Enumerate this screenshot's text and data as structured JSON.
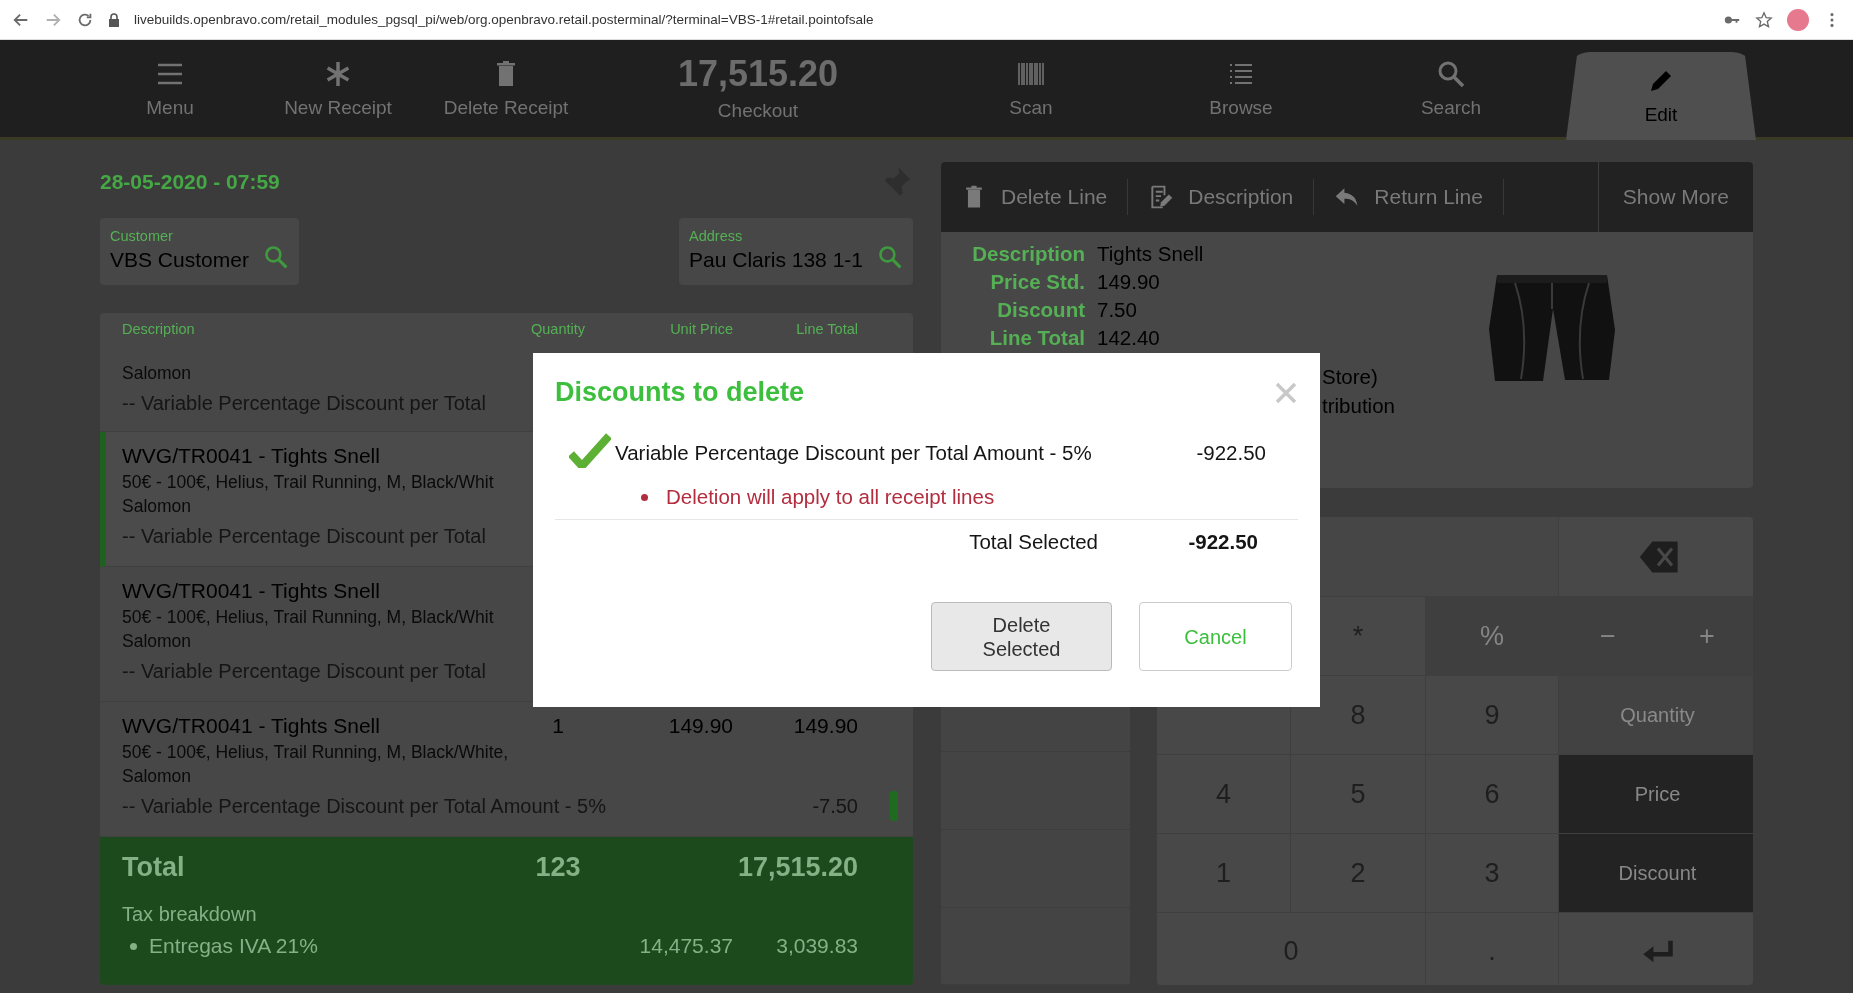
{
  "browser": {
    "url": "livebuilds.openbravo.com/retail_modules_pgsql_pi/web/org.openbravo.retail.posterminal/?terminal=VBS-1#retail.pointofsale"
  },
  "toolbar": [
    {
      "label": "Menu",
      "selected": false
    },
    {
      "label": "New Receipt",
      "selected": false
    },
    {
      "label": "Delete Receipt",
      "selected": false
    },
    {
      "label": "Checkout",
      "amount": "17,515.20",
      "selected": false
    },
    {
      "label": "Scan",
      "selected": false
    },
    {
      "label": "Browse",
      "selected": false
    },
    {
      "label": "Search",
      "selected": false
    },
    {
      "label": "Edit",
      "selected": true
    }
  ],
  "receipt": {
    "date": "28-05-2020 - 07:59",
    "customer": {
      "label": "Customer",
      "value": "VBS Customer"
    },
    "address": {
      "label": "Address",
      "value": "Pau Claris 138 1-1"
    },
    "columns": [
      "Description",
      "Quantity",
      "Unit Price",
      "Line Total"
    ],
    "lines": [
      {
        "selected": false,
        "attributes": [
          "Salomon"
        ],
        "discount": {
          "text": "-- Variable Percentage Discount per Total"
        }
      },
      {
        "selected": true,
        "product": "WVG/TR0041 - Tights Snell",
        "attributes": [
          "50€ - 100€, Helius, Trail Running, M, Black/Whit",
          "Salomon"
        ],
        "discount": {
          "text": "-- Variable Percentage Discount per Total"
        }
      },
      {
        "selected": false,
        "product": "WVG/TR0041 - Tights Snell",
        "attributes": [
          "50€ - 100€, Helius, Trail Running, M, Black/Whit",
          "Salomon"
        ],
        "discount": {
          "text": "-- Variable Percentage Discount per Total"
        }
      },
      {
        "selected": false,
        "product": "WVG/TR0041 - Tights Snell",
        "quantity": "1",
        "unit_price": "149.90",
        "line_total": "149.90",
        "attributes": [
          "50€ - 100€, Helius, Trail Running, M, Black/White,",
          "Salomon"
        ],
        "discount": {
          "text": "-- Variable Percentage Discount per Total Amount - 5%",
          "amount": "-7.50"
        }
      }
    ],
    "total": {
      "label": "Total",
      "quantity": "123",
      "amount": "17,515.20",
      "tax_title": "Tax breakdown",
      "taxes": [
        {
          "name": "Entregas IVA 21%",
          "base": "14,475.37",
          "amount": "3,039.83"
        }
      ]
    }
  },
  "line_panel": {
    "actions": [
      "Delete Line",
      "Description",
      "Return Line"
    ],
    "more": "Show More",
    "fields": [
      {
        "label": "Description",
        "value": "Tights Snell"
      },
      {
        "label": "Price Std.",
        "value": "149.90"
      },
      {
        "label": "Discount",
        "value": "7.50"
      },
      {
        "label": "Line Total",
        "value": "142.40"
      }
    ],
    "extra": [
      "Store)",
      "tribution"
    ],
    "image": {
      "kind": "picture"
    }
  },
  "keypad": [
    {
      "kind": "display"
    },
    {
      "kind": "backspace"
    },
    {
      "kind": "key",
      "label": "*",
      "disabled": false
    },
    {
      "kind": "key",
      "label": "%",
      "disabled": true
    },
    {
      "kind": "pair",
      "keys": [
        {
          "label": "−",
          "disabled": true
        },
        {
          "label": "+",
          "disabled": true
        }
      ]
    },
    {
      "kind": "blank"
    },
    {
      "kind": "key",
      "label": "8",
      "disabled": false
    },
    {
      "kind": "key",
      "label": "9",
      "disabled": false
    },
    {
      "kind": "function",
      "label": "Quantity",
      "disabled": true
    },
    {
      "kind": "key",
      "label": "4",
      "disabled": false
    },
    {
      "kind": "key",
      "label": "5",
      "disabled": false
    },
    {
      "kind": "key",
      "label": "6",
      "disabled": false
    },
    {
      "kind": "function",
      "label": "Price",
      "disabled": false
    },
    {
      "kind": "key",
      "label": "1",
      "disabled": false
    },
    {
      "kind": "key",
      "label": "2",
      "disabled": false
    },
    {
      "kind": "key",
      "label": "3",
      "disabled": false
    },
    {
      "kind": "function",
      "label": "Discount",
      "disabled": false
    },
    {
      "kind": "wide",
      "label": "0",
      "disabled": false
    },
    {
      "kind": "key",
      "label": ".",
      "disabled": false
    },
    {
      "kind": "enter"
    }
  ],
  "dialog": {
    "title": "Discounts to delete",
    "items": [
      {
        "checked": true,
        "name": "Variable Percentage Discount per Total Amount - 5%",
        "amount": "-922.50",
        "notes": [
          "Deletion will apply to all receipt lines"
        ]
      }
    ],
    "total": {
      "label": "Total Selected",
      "value": "-922.50"
    },
    "buttons": [
      {
        "label": "Delete Selected",
        "kind": "secondary"
      },
      {
        "label": "Cancel",
        "kind": "primary"
      }
    ]
  }
}
